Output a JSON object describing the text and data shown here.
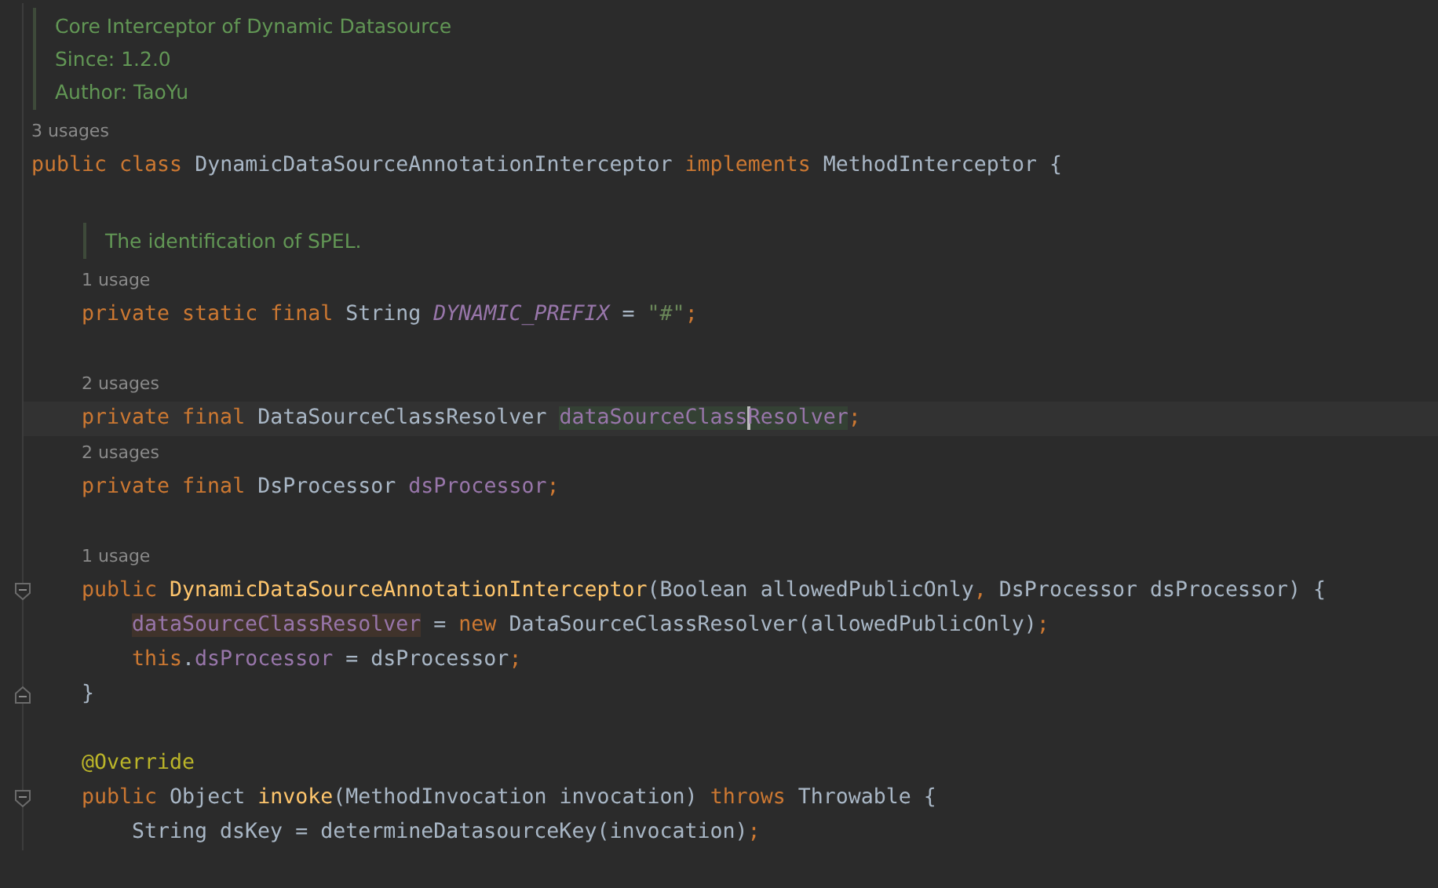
{
  "lines": [
    {
      "kind": "doc",
      "items": [
        {
          "kind": "text",
          "text": "Core Interceptor of Dynamic Datasource"
        },
        {
          "kind": "tag",
          "label": "Since:",
          "value": "1.2.0"
        },
        {
          "kind": "tag",
          "label": "Author:",
          "value": "TaoYu"
        }
      ]
    },
    {
      "kind": "usages",
      "text": "3 usages"
    },
    {
      "kind": "code",
      "tokens": [
        {
          "kind": "keyword",
          "text": "public class "
        },
        {
          "kind": "plain",
          "text": "DynamicDataSourceAnnotationInterceptor "
        },
        {
          "kind": "keyword",
          "text": "implements "
        },
        {
          "kind": "plain",
          "text": "MethodInterceptor {"
        }
      ],
      "children": [
        {
          "kind": "blank"
        },
        {
          "kind": "doc",
          "items": [
            {
              "kind": "text",
              "text": "The identification of SPEL."
            }
          ]
        },
        {
          "kind": "usages",
          "text": "1 usage"
        },
        {
          "kind": "code",
          "tokens": [
            {
              "kind": "keyword",
              "text": "private static final "
            },
            {
              "kind": "plain",
              "text": "String "
            },
            {
              "kind": "static",
              "text": "DYNAMIC_PREFIX"
            },
            {
              "kind": "plain",
              "text": " = "
            },
            {
              "kind": "string",
              "text": "\"#\""
            },
            {
              "kind": "punct",
              "text": ";"
            }
          ]
        },
        {
          "kind": "blank"
        },
        {
          "kind": "usages",
          "text": "2 usages"
        },
        {
          "kind": "code",
          "current": true,
          "tokens": [
            {
              "kind": "keyword",
              "text": "private final "
            },
            {
              "kind": "plain",
              "text": "DataSourceClassResolver "
            },
            {
              "kind": "field",
              "text": "dataSourceClass",
              "highlighted": true
            },
            {
              "kind": "field",
              "text": "Resolver",
              "highlighted": true,
              "caret": true
            },
            {
              "kind": "punct",
              "text": ";"
            }
          ]
        },
        {
          "kind": "usages",
          "text": "2 usages"
        },
        {
          "kind": "code",
          "tokens": [
            {
              "kind": "keyword",
              "text": "private final "
            },
            {
              "kind": "plain",
              "text": "DsProcessor "
            },
            {
              "kind": "field",
              "text": "dsProcessor"
            },
            {
              "kind": "punct",
              "text": ";"
            }
          ]
        },
        {
          "kind": "blank"
        },
        {
          "kind": "usages",
          "text": "1 usage"
        },
        {
          "kind": "code",
          "fold_start": true,
          "tokens": [
            {
              "kind": "keyword",
              "text": "public "
            },
            {
              "kind": "method",
              "text": "DynamicDataSourceAnnotationInterceptor"
            },
            {
              "kind": "plain",
              "text": "(Boolean allowedPublicOnly"
            },
            {
              "kind": "punct",
              "text": ", "
            },
            {
              "kind": "plain",
              "text": "DsProcessor dsProcessor) {"
            }
          ],
          "children": [
            {
              "kind": "code",
              "tokens": [
                {
                  "kind": "field",
                  "text": "dataSourceClassResolver",
                  "written": true
                },
                {
                  "kind": "plain",
                  "text": " = "
                },
                {
                  "kind": "keyword",
                  "text": "new "
                },
                {
                  "kind": "plain",
                  "text": "DataSourceClassResolver(allowedPublicOnly)"
                },
                {
                  "kind": "punct",
                  "text": ";"
                }
              ]
            },
            {
              "kind": "code",
              "tokens": [
                {
                  "kind": "keyword",
                  "text": "this"
                },
                {
                  "kind": "plain",
                  "text": "."
                },
                {
                  "kind": "field",
                  "text": "dsProcessor"
                },
                {
                  "kind": "plain",
                  "text": " = dsProcessor"
                },
                {
                  "kind": "punct",
                  "text": ";"
                }
              ]
            }
          ]
        },
        {
          "kind": "code",
          "fold_end": true,
          "tokens": [
            {
              "kind": "plain",
              "text": "}"
            }
          ]
        },
        {
          "kind": "blank"
        },
        {
          "kind": "code",
          "tokens": [
            {
              "kind": "annotation",
              "text": "@Override"
            }
          ]
        },
        {
          "kind": "code",
          "fold_start": true,
          "tokens": [
            {
              "kind": "keyword",
              "text": "public "
            },
            {
              "kind": "plain",
              "text": "Object "
            },
            {
              "kind": "method",
              "text": "invoke"
            },
            {
              "kind": "plain",
              "text": "(MethodInvocation invocation) "
            },
            {
              "kind": "keyword",
              "text": "throws "
            },
            {
              "kind": "plain",
              "text": "Throwable {"
            }
          ],
          "children": [
            {
              "kind": "code",
              "tokens": [
                {
                  "kind": "plain",
                  "text": "String dsKey = determineDatasourceKey(invocation)"
                },
                {
                  "kind": "punct",
                  "text": ";"
                }
              ]
            }
          ]
        }
      ]
    }
  ]
}
